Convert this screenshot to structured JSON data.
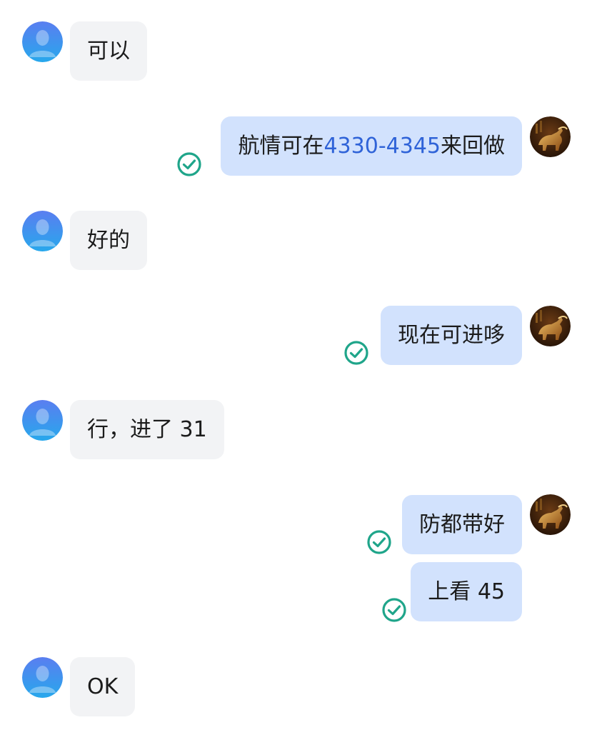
{
  "messages": [
    {
      "side": "in",
      "parts": [
        {
          "text": "可以"
        }
      ]
    },
    {
      "side": "out",
      "parts": [
        {
          "text": "航情可在"
        },
        {
          "text": "4330-4345",
          "link": true
        },
        {
          "text": "来回做"
        }
      ],
      "status": "read"
    },
    {
      "side": "in",
      "parts": [
        {
          "text": "好的"
        }
      ]
    },
    {
      "side": "out",
      "parts": [
        {
          "text": "现在可进哆"
        }
      ],
      "status": "read"
    },
    {
      "side": "in",
      "parts": [
        {
          "text": "行，进了 31"
        }
      ]
    },
    {
      "side": "out",
      "parts": [
        {
          "text": "防都带好"
        }
      ],
      "status": "read"
    },
    {
      "side": "out",
      "parts": [
        {
          "text": "上看 45"
        }
      ],
      "status": "read"
    },
    {
      "side": "in",
      "parts": [
        {
          "text": "OK"
        }
      ]
    }
  ],
  "colors": {
    "incoming_bubble": "#f2f3f5",
    "outgoing_bubble": "#d2e2fd",
    "link": "#2f63d8",
    "read_check": "#1fa58a"
  },
  "icons": {
    "incoming_avatar": "default-user-avatar-icon",
    "outgoing_avatar": "bull-avatar-icon",
    "status": "read-check-icon"
  }
}
